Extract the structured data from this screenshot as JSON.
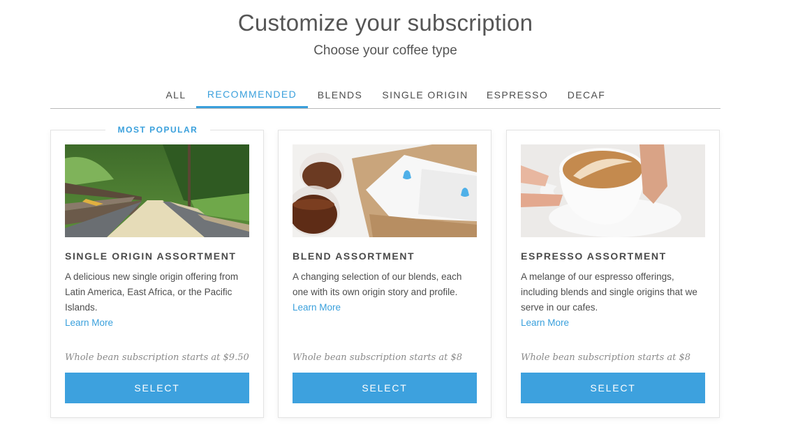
{
  "header": {
    "title": "Customize your subscription",
    "subtitle": "Choose your coffee type"
  },
  "tabs": [
    {
      "label": "ALL",
      "active": false
    },
    {
      "label": "RECOMMENDED",
      "active": true
    },
    {
      "label": "BLENDS",
      "active": false
    },
    {
      "label": "SINGLE ORIGIN",
      "active": false
    },
    {
      "label": "ESPRESSO",
      "active": false
    },
    {
      "label": "DECAF",
      "active": false
    }
  ],
  "colors": {
    "accent": "#3aa0dc",
    "button": "#3da1de",
    "text": "#4a4a4a",
    "price_text": "#8a8a8a"
  },
  "cards": [
    {
      "badge": "MOST POPULAR",
      "image": "coffee-drying-beds-photo",
      "title": "SINGLE ORIGIN ASSORTMENT",
      "description": "A delicious new single origin offering from Latin America, East Africa, or the Pacific Islands.",
      "link": "Learn More",
      "price": "Whole bean subscription starts at $9.50",
      "button": "SELECT"
    },
    {
      "image": "blend-box-and-glasses-photo",
      "title": "BLEND ASSORTMENT",
      "description": "A changing selection of our blends, each one with its own origin story and profile.",
      "link": "Learn More",
      "price": "Whole bean subscription starts at $8",
      "button": "SELECT"
    },
    {
      "image": "latte-art-cup-photo",
      "title": "ESPRESSO ASSORTMENT",
      "description": "A melange of our espresso offerings, including blends and single origins that we serve in our cafes.",
      "link": "Learn More",
      "price": "Whole bean subscription starts at $8",
      "button": "SELECT"
    }
  ]
}
